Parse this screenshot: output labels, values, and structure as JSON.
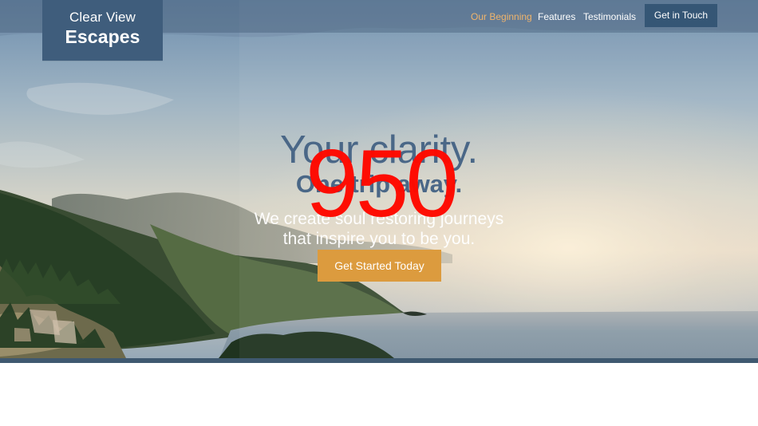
{
  "brand": {
    "line1": "Clear View",
    "line2": "Escapes"
  },
  "navigation": {
    "items": [
      "Our Beginning",
      "Features",
      "Testimonials"
    ],
    "active_item": "Our Beginning",
    "contact_button": "Get in Touch"
  },
  "hero": {
    "headline": "Your clarity.",
    "subheadline": "One trip away.",
    "description_lines": [
      "We create soul restoring journeys",
      "that inspire you to be you."
    ],
    "cta_button": "Get Started Today"
  },
  "overlay": {
    "number": "950"
  },
  "colors": {
    "brand_blue": "#3f5d7c",
    "navigation_active": "#efb46c",
    "headline_blue": "#4a6787",
    "cta_orange": "#dc9b3e",
    "overlay_red": "#ff0a00"
  }
}
